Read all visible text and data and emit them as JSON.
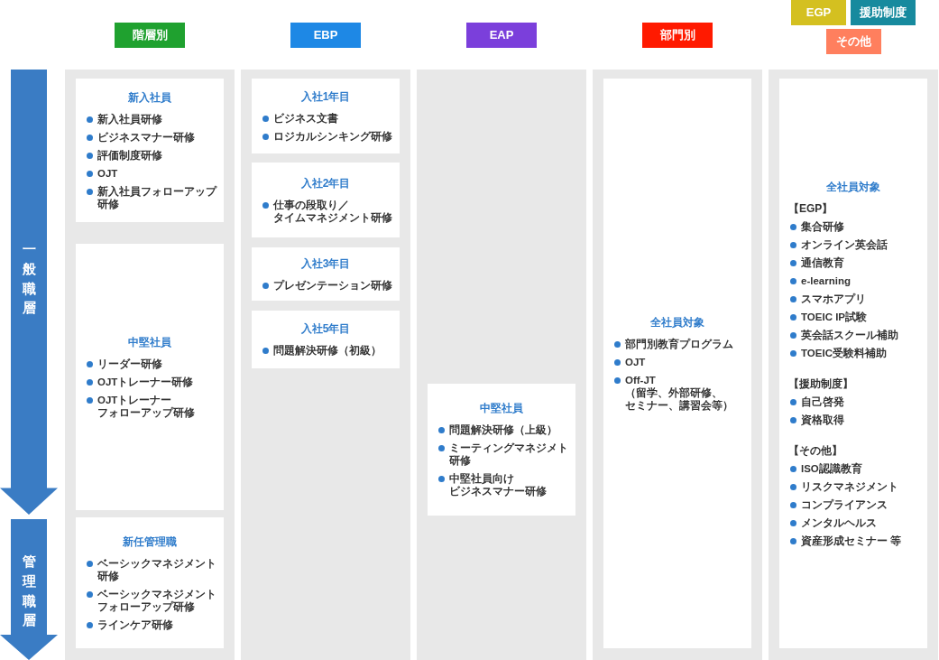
{
  "levels": [
    {
      "label": "一般職層"
    },
    {
      "label": "管理職層"
    }
  ],
  "columns": [
    {
      "tags": [
        {
          "label": "階層別",
          "color": "#1fa12f"
        }
      ],
      "cards": [
        {
          "title": "新入社員",
          "groups": [
            {
              "items": [
                [
                  "新入社員研修"
                ],
                [
                  "ビジネスマナー研修"
                ],
                [
                  "評価制度研修"
                ],
                [
                  "OJT"
                ],
                [
                  "新入社員フォローアップ",
                  "研修"
                ]
              ]
            }
          ]
        },
        {
          "title": "中堅社員",
          "groups": [
            {
              "items": [
                [
                  "リーダー研修"
                ],
                [
                  "OJTトレーナー研修"
                ],
                [
                  "OJTトレーナー",
                  "フォローアップ研修"
                ]
              ]
            }
          ]
        },
        {
          "title": "新任管理職",
          "groups": [
            {
              "items": [
                [
                  "ベーシックマネジメント",
                  "研修"
                ],
                [
                  "ベーシックマネジメント",
                  "フォローアップ研修"
                ],
                [
                  "ラインケア研修"
                ]
              ]
            }
          ]
        }
      ]
    },
    {
      "tags": [
        {
          "label": "EBP",
          "color": "#1e88e5"
        }
      ],
      "cards": [
        {
          "title": "入社1年目",
          "groups": [
            {
              "items": [
                [
                  "ビジネス文書"
                ],
                [
                  "ロジカルシンキング研修"
                ]
              ]
            }
          ]
        },
        {
          "title": "入社2年目",
          "groups": [
            {
              "items": [
                [
                  "仕事の段取り／",
                  "タイムマネジメント研修"
                ]
              ]
            }
          ]
        },
        {
          "title": "入社3年目",
          "groups": [
            {
              "items": [
                [
                  "プレゼンテーション研修"
                ]
              ]
            }
          ]
        },
        {
          "title": "入社5年目",
          "groups": [
            {
              "items": [
                [
                  "問題解決研修（初級）"
                ]
              ]
            }
          ]
        }
      ]
    },
    {
      "tags": [
        {
          "label": "EAP",
          "color": "#7b3fdb"
        }
      ],
      "cards": [
        {
          "title": "中堅社員",
          "groups": [
            {
              "items": [
                [
                  "問題解決研修（上級）"
                ],
                [
                  "ミーティングマネジメト",
                  "研修"
                ],
                [
                  "中堅社員向け",
                  "ビジネスマナー研修"
                ]
              ]
            }
          ]
        }
      ]
    },
    {
      "tags": [
        {
          "label": "部門別",
          "color": "#ff1a00"
        }
      ],
      "cards": [
        {
          "title": "全社員対象",
          "groups": [
            {
              "items": [
                [
                  "部門別教育プログラム"
                ],
                [
                  "OJT"
                ],
                [
                  "Off-JT",
                  "（留学、外部研修、",
                  "セミナー、講習会等）"
                ]
              ]
            }
          ]
        }
      ]
    },
    {
      "tags": [
        {
          "label": "EGP",
          "color": "#d4c020"
        },
        {
          "label": "援助制度",
          "color": "#178a9e"
        },
        {
          "label": "その他",
          "color": "#ff7f5e"
        }
      ],
      "cards": [
        {
          "title": "全社員対象",
          "groups": [
            {
              "heading": "【EGP】",
              "items": [
                [
                  "集合研修"
                ],
                [
                  "オンライン英会話"
                ],
                [
                  "通信教育"
                ],
                [
                  "e-learning"
                ],
                [
                  "スマホアプリ"
                ],
                [
                  "TOEIC IP試験"
                ],
                [
                  "英会話スクール補助"
                ],
                [
                  "TOEIC受験料補助"
                ]
              ]
            },
            {
              "heading": "【援助制度】",
              "items": [
                [
                  "自己啓発"
                ],
                [
                  "資格取得"
                ]
              ]
            },
            {
              "heading": "【その他】",
              "items": [
                [
                  "ISO認識教育"
                ],
                [
                  "リスクマネジメント"
                ],
                [
                  "コンプライアンス"
                ],
                [
                  "メンタルヘルス"
                ],
                [
                  "資産形成セミナー 等"
                ]
              ]
            }
          ]
        }
      ]
    }
  ]
}
